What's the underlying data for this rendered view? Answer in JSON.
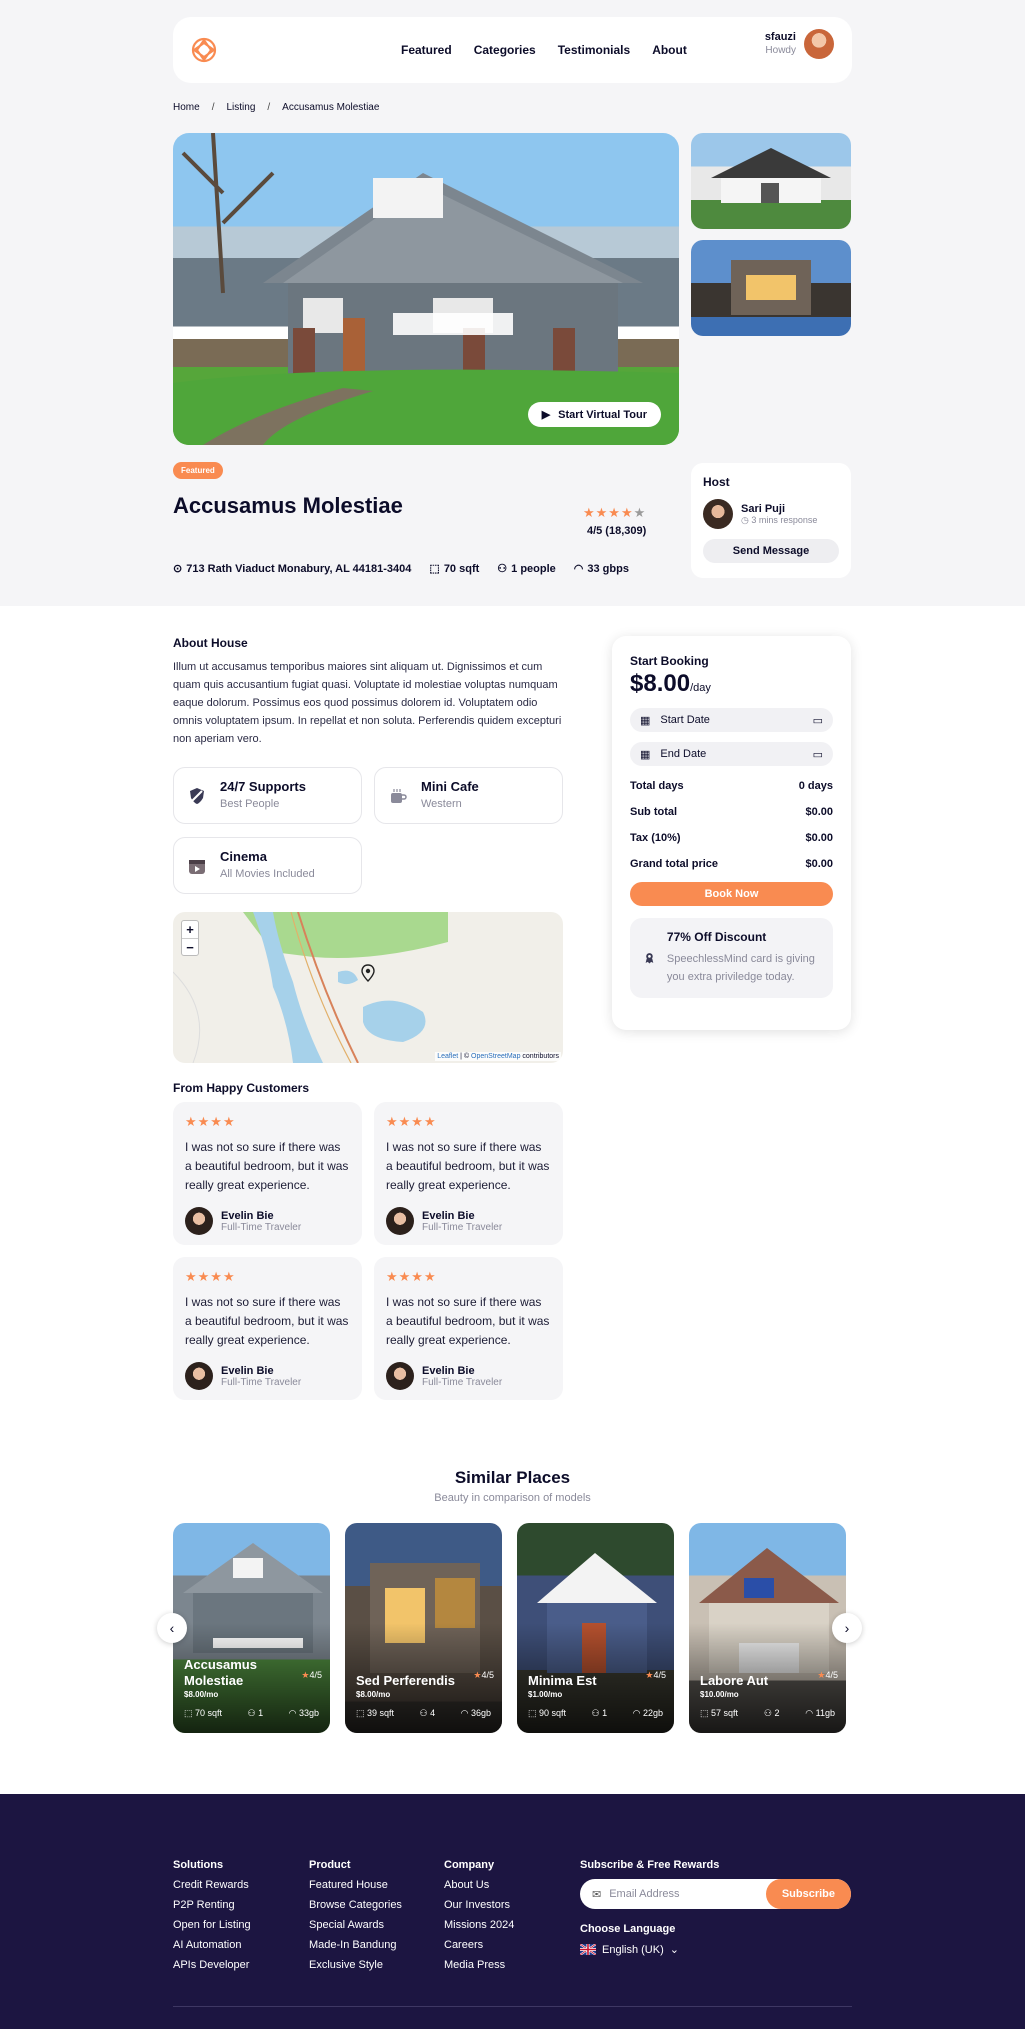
{
  "nav": {
    "menu": [
      "Featured",
      "Categories",
      "Testimonials",
      "About"
    ],
    "user_name": "sfauzi",
    "user_greeting": "Howdy"
  },
  "breadcrumb": [
    "Home",
    "Listing",
    "Accusamus Molestiae"
  ],
  "hero": {
    "virtual_tour_label": "Start Virtual Tour"
  },
  "listing": {
    "badge": "Featured",
    "title": "Accusamus Molestiae",
    "rating_stars": 4,
    "rating_text": "4/5 (18,309)",
    "address": "713 Rath Viaduct Monabury, AL 44181-3404",
    "size": "70 sqft",
    "people": "1 people",
    "internet": "33 gbps"
  },
  "host": {
    "heading": "Host",
    "name": "Sari Puji",
    "response": "3 mins response",
    "button": "Send Message"
  },
  "about": {
    "heading": "About House",
    "text": "Illum ut accusamus temporibus maiores sint aliquam ut. Dignissimos et cum quam quis accusantium fugiat quasi. Voluptate id molestiae voluptas numquam eaque dolorum. Possimus eos quod possimus dolorem id. Voluptatem odio omnis voluptatem ipsum. In repellat et non soluta. Perferendis quidem excepturi non aperiam vero."
  },
  "features": [
    {
      "title": "24/7 Supports",
      "sub": "Best People",
      "icon": "shield-icon"
    },
    {
      "title": "Mini Cafe",
      "sub": "Western",
      "icon": "cup-icon"
    },
    {
      "title": "Cinema",
      "sub": "All Movies Included",
      "icon": "video-icon"
    }
  ],
  "map": {
    "zoom_in": "+",
    "zoom_out": "−",
    "attribution_leaflet": "Leaflet",
    "attribution_sep": " | © ",
    "attribution_osm": "OpenStreetMap",
    "attribution_end": " contributors"
  },
  "reviews": {
    "heading": "From Happy Customers",
    "items": [
      {
        "stars": "★★★★",
        "text": "I was not so sure if there was a beautiful bedroom, but it was really great experience.",
        "name": "Evelin Bie",
        "role": "Full-Time Traveler"
      },
      {
        "stars": "★★★★",
        "text": "I was not so sure if there was a beautiful bedroom, but it was really great experience.",
        "name": "Evelin Bie",
        "role": "Full-Time Traveler"
      },
      {
        "stars": "★★★★",
        "text": "I was not so sure if there was a beautiful bedroom, but it was really great experience.",
        "name": "Evelin Bie",
        "role": "Full-Time Traveler"
      },
      {
        "stars": "★★★★",
        "text": "I was not so sure if there was a beautiful bedroom, but it was really great experience.",
        "name": "Evelin Bie",
        "role": "Full-Time Traveler"
      }
    ]
  },
  "booking": {
    "heading": "Start Booking",
    "price": "$8.00",
    "per": "/day",
    "start_date": "Start Date",
    "end_date": "End Date",
    "lines": [
      {
        "label": "Total days",
        "value": "0 days"
      },
      {
        "label": "Sub total",
        "value": "$0.00"
      },
      {
        "label": "Tax (10%)",
        "value": "$0.00"
      },
      {
        "label": "Grand total price",
        "value": "$0.00"
      }
    ],
    "button": "Book Now",
    "discount_title": "77% Off Discount",
    "discount_text": "SpeechlessMind card is giving you extra priviledge today."
  },
  "similar": {
    "heading": "Similar Places",
    "subheading": "Beauty in comparison of models",
    "items": [
      {
        "name": "Accusamus Molestiae",
        "price": "$8.00/mo",
        "rating": "4/5",
        "size": "70 sqft",
        "people": "1",
        "net": "33gb"
      },
      {
        "name": "Sed Perferendis",
        "price": "$8.00/mo",
        "rating": "4/5",
        "size": "39 sqft",
        "people": "4",
        "net": "36gb"
      },
      {
        "name": "Minima Est",
        "price": "$1.00/mo",
        "rating": "4/5",
        "size": "90 sqft",
        "people": "1",
        "net": "22gb"
      },
      {
        "name": "Labore Aut",
        "price": "$10.00/mo",
        "rating": "4/5",
        "size": "57 sqft",
        "people": "2",
        "net": "11gb"
      }
    ]
  },
  "footer": {
    "columns": [
      {
        "heading": "Solutions",
        "links": [
          "Credit Rewards",
          "P2P Renting",
          "Open for Listing",
          "AI Automation",
          "APIs Developer"
        ]
      },
      {
        "heading": "Product",
        "links": [
          "Featured House",
          "Browse Categories",
          "Special Awards",
          "Made-In Bandung",
          "Exclusive Style"
        ]
      },
      {
        "heading": "Company",
        "links": [
          "About Us",
          "Our Investors",
          "Missions 2024",
          "Careers",
          "Media Press"
        ]
      }
    ],
    "subscribe_heading": "Subscribe & Free Rewards",
    "email_placeholder": "Email Address",
    "subscribe_button": "Subscribe",
    "language_heading": "Choose Language",
    "language": "English (UK)"
  },
  "colors": {
    "accent": "#f98b51",
    "footer": "#1c1541",
    "text": "#0c0c29"
  }
}
